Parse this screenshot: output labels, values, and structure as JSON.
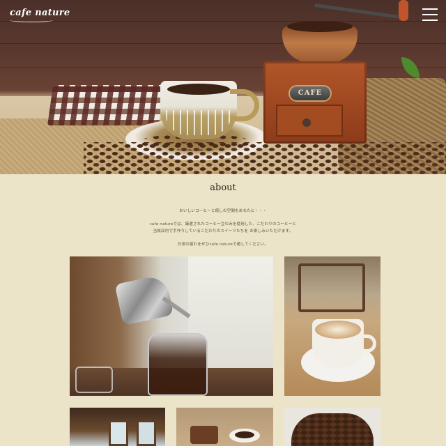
{
  "header": {
    "logo": "cafe nature",
    "menu_icon": "hamburger-menu-icon"
  },
  "hero": {
    "image": "coffee-grinder-cup-beans-photo",
    "plate_text": "CAFE"
  },
  "about": {
    "title": "about",
    "line1": "おいしいコーヒーと癒しの空間をあなたに・・・",
    "line2": "cafe natureでは、厳選されたコーヒー豆のみを使用した、こだわりのコーヒーと",
    "line3": "当該店内で手作りしているこだわりのスイーツたちを お楽しみいただけます。",
    "line4": "日頃の疲れをぜひcafe natureで癒してください。"
  },
  "gallery": {
    "photos": [
      "pour-over-coffee-photo",
      "latte-art-cup-photo",
      "cafe-interior-photo",
      "cake-and-coffee-photo",
      "coffee-beans-photo"
    ]
  },
  "colors": {
    "background": "#ece4c8",
    "text": "#3b3128",
    "header_text": "#ffffff"
  }
}
